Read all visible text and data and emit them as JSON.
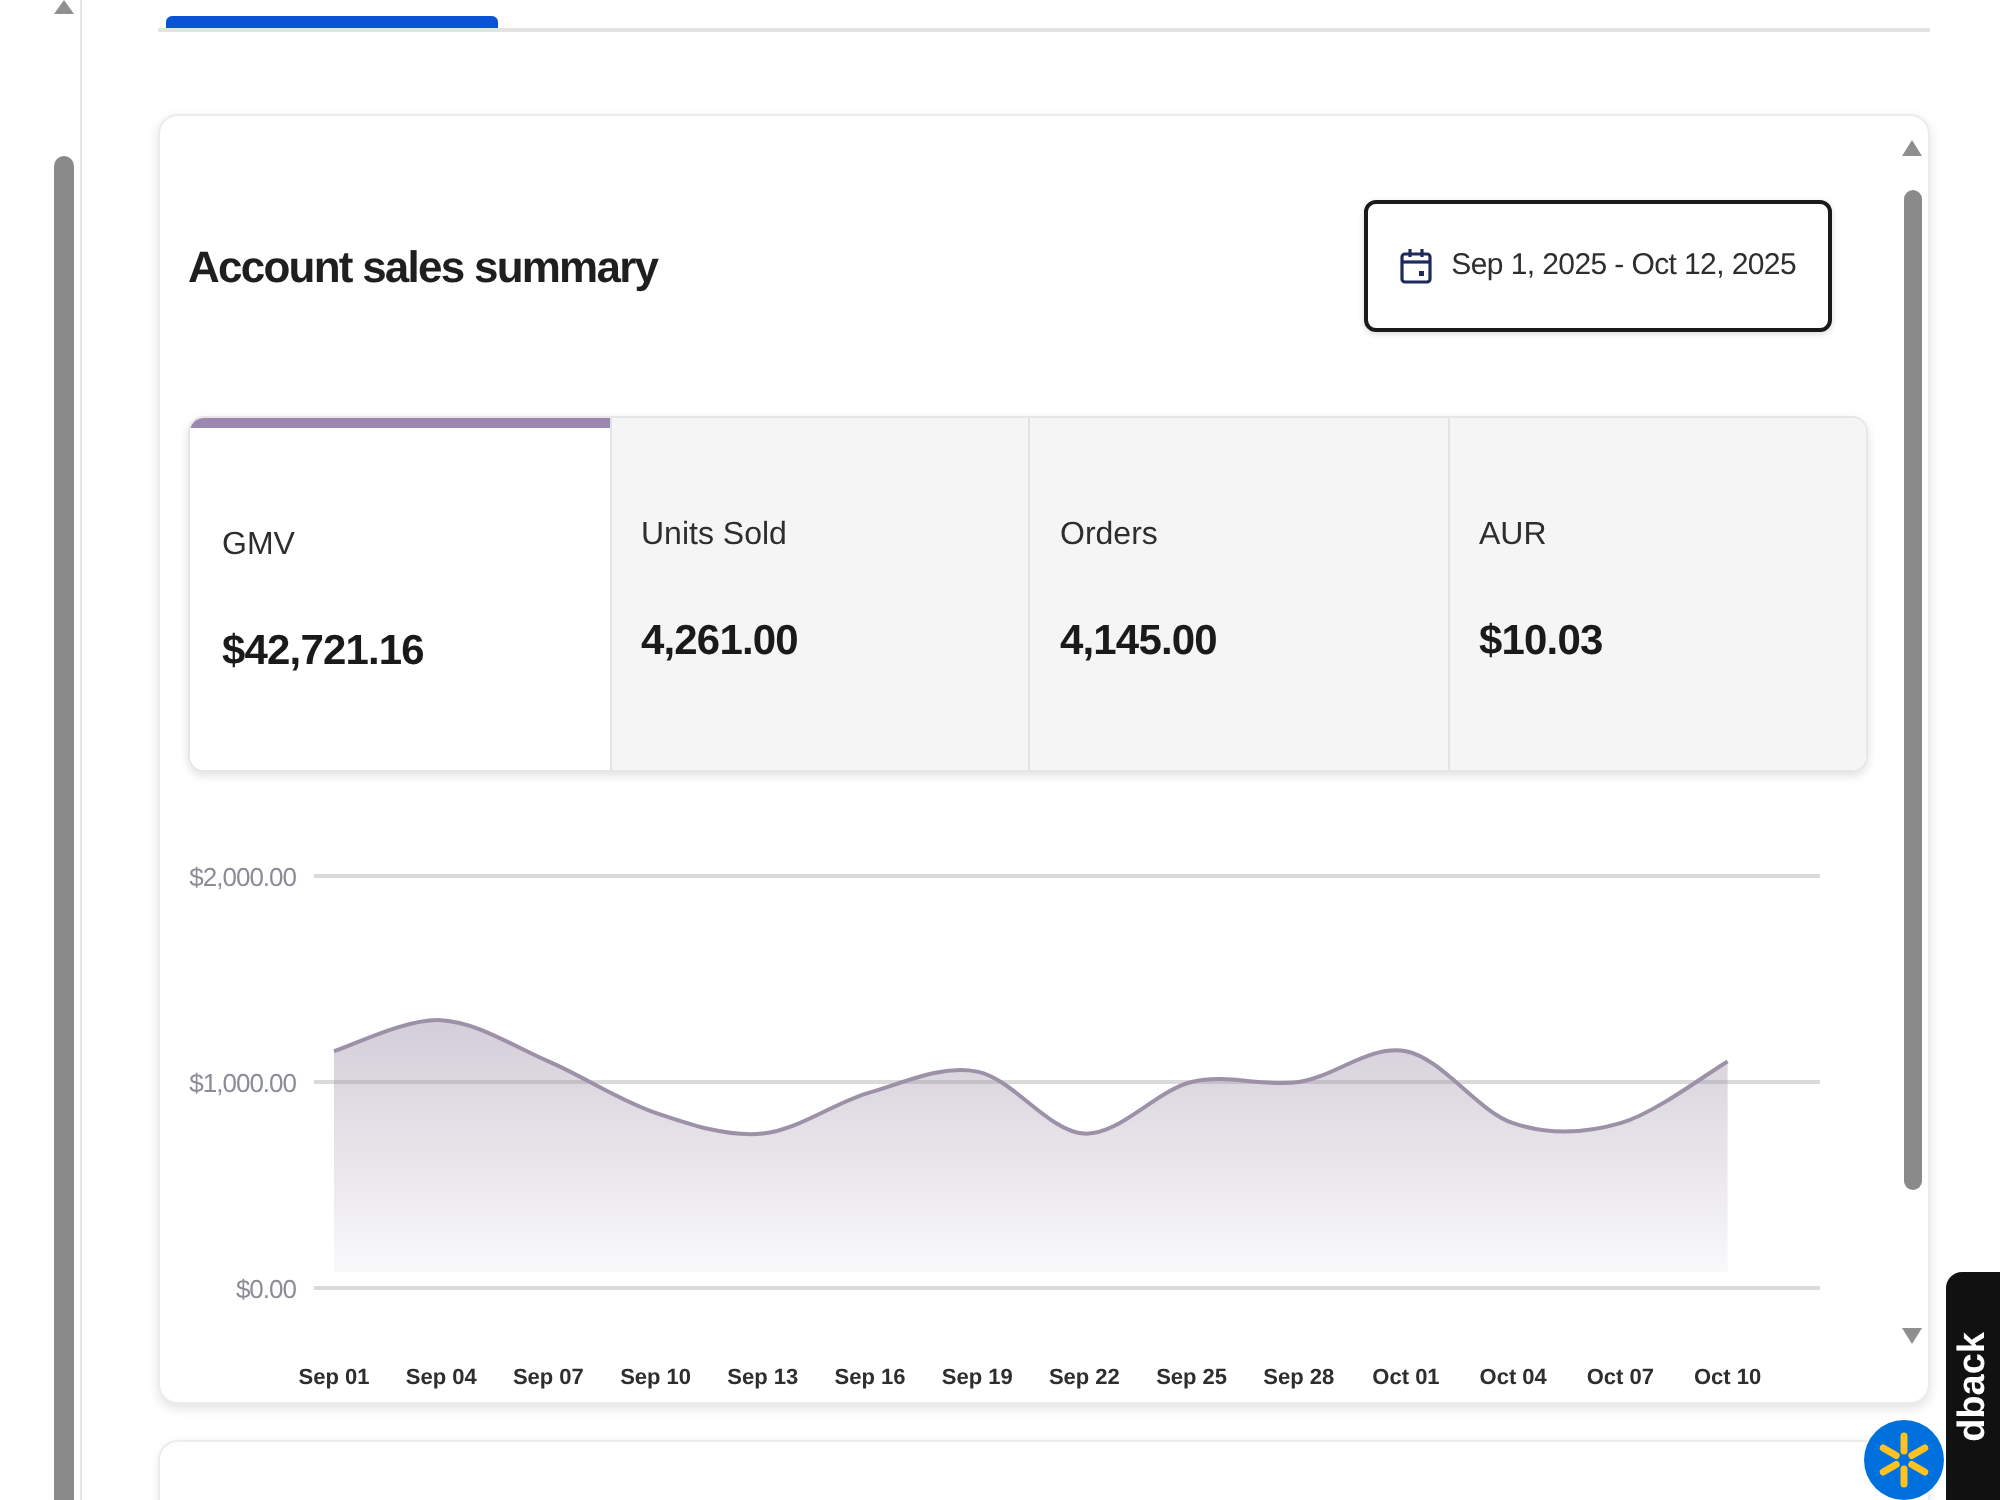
{
  "summary": {
    "title": "Account sales summary",
    "date_range": "Sep 1, 2025 - Oct 12, 2025",
    "metrics": [
      {
        "label": "GMV",
        "value": "$42,721.16",
        "selected": true
      },
      {
        "label": "Units Sold",
        "value": "4,261.00",
        "selected": false
      },
      {
        "label": "Orders",
        "value": "4,145.00",
        "selected": false
      },
      {
        "label": "AUR",
        "value": "$10.03",
        "selected": false
      }
    ],
    "chart_data": {
      "type": "area",
      "ylim": [
        0,
        2000
      ],
      "yticks": [
        {
          "value": 0,
          "label": "$0.00"
        },
        {
          "value": 1000,
          "label": "$1,000.00"
        },
        {
          "value": 2000,
          "label": "$2,000.00"
        }
      ],
      "categories": [
        "Sep 01",
        "Sep 04",
        "Sep 07",
        "Sep 10",
        "Sep 13",
        "Sep 16",
        "Sep 19",
        "Sep 22",
        "Sep 25",
        "Sep 28",
        "Oct 01",
        "Oct 04",
        "Oct 07",
        "Oct 10"
      ],
      "series": [
        {
          "color": "#9d91a8",
          "values": [
            1150,
            1300,
            1100,
            850,
            750,
            950,
            1050,
            750,
            1000,
            1000,
            1150,
            800,
            800,
            1100
          ]
        }
      ]
    }
  },
  "feedback_tab": {
    "label": "dback"
  }
}
